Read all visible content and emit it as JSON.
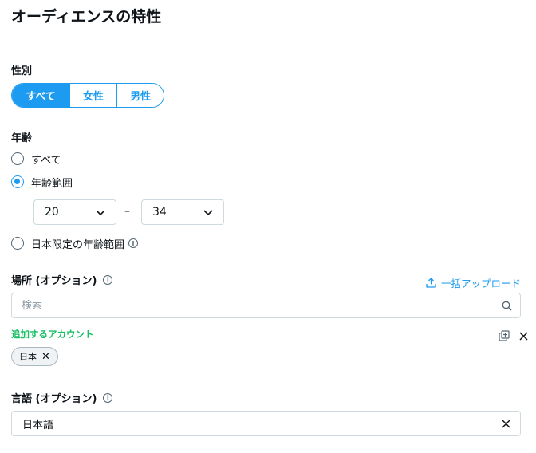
{
  "page": {
    "title": "オーディエンスの特性"
  },
  "gender": {
    "label": "性別",
    "options": [
      "すべて",
      "女性",
      "男性"
    ],
    "selected": "すべて"
  },
  "age": {
    "label": "年齢",
    "options": [
      "すべて",
      "年齢範囲",
      "日本限定の年齢範囲"
    ],
    "selected": "年齢範囲",
    "from": "20",
    "separator": "–",
    "to": "34"
  },
  "location": {
    "label": "場所 (オプション)",
    "bulk_upload": "一括アップロード",
    "search_placeholder": "検索",
    "added_label": "追加するアカウント",
    "chips": [
      "日本"
    ]
  },
  "language": {
    "label": "言語 (オプション)",
    "value": "日本語"
  },
  "colors": {
    "accent": "#1d9bf0",
    "success": "#17bf63",
    "border": "#cfd9de"
  },
  "icons": [
    "info-icon",
    "chevron-down-icon",
    "upload-icon",
    "search-icon",
    "copy-icon",
    "close-icon"
  ]
}
